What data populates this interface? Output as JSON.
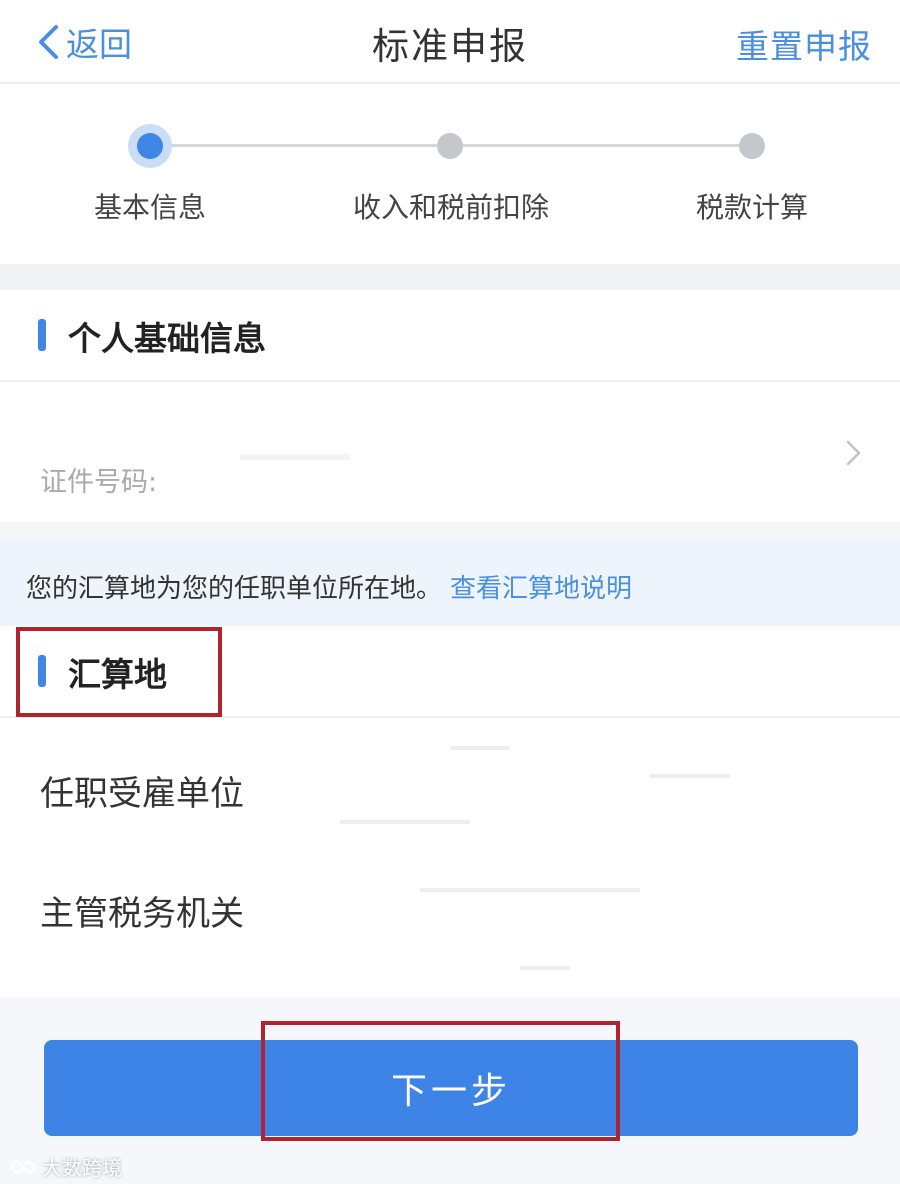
{
  "header": {
    "back_label": "返回",
    "title": "标准申报",
    "reset_label": "重置申报"
  },
  "stepper": {
    "steps": [
      {
        "label": "基本信息",
        "state": "active"
      },
      {
        "label": "收入和税前扣除",
        "state": "pending"
      },
      {
        "label": "税款计算",
        "state": "pending"
      }
    ]
  },
  "personal": {
    "section_title": "个人基础信息",
    "id_label": "证件号码:"
  },
  "notice": {
    "text": "您的汇算地为您的任职单位所在地。",
    "link": "查看汇算地说明"
  },
  "settlement": {
    "section_title": "汇算地",
    "rows": [
      {
        "label": "任职受雇单位"
      },
      {
        "label": "主管税务机关"
      }
    ]
  },
  "footer": {
    "next_label": "下一步"
  },
  "watermark": {
    "text": "大数跨境"
  },
  "colors": {
    "accent": "#3d84e6",
    "link": "#4a8fe0",
    "highlight": "#b0242e",
    "notice_bg": "#eef4fb"
  }
}
